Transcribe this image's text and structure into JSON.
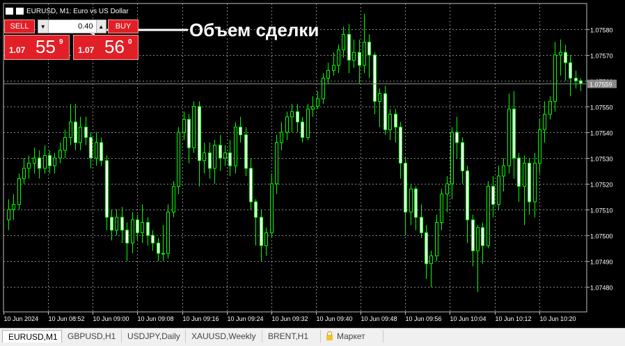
{
  "window": {
    "title": "EURUSD, M1:  Euro vs US Dollar"
  },
  "order_panel": {
    "sell_label": "SELL",
    "buy_label": "BUY",
    "volume": "0.40",
    "sell_price": {
      "prefix": "1.07",
      "big": "55",
      "sup": "9"
    },
    "buy_price": {
      "prefix": "1.07",
      "big": "56",
      "sup": "0"
    }
  },
  "annotation": {
    "text": "Объем сделки"
  },
  "tabs": [
    {
      "label": "EURUSD,M1",
      "active": true
    },
    {
      "label": "GBPUSD,H1",
      "active": false
    },
    {
      "label": "USDJPY,Daily",
      "active": false
    },
    {
      "label": "XAUUSD,Weekly",
      "active": false
    },
    {
      "label": "BRENT,H1",
      "active": false
    },
    {
      "label": "Маркет",
      "active": false,
      "icon": "lock-icon"
    }
  ],
  "colors": {
    "background": "#000000",
    "grid": "#c0c0c0",
    "bull": "#00ff00",
    "bear": "#ffffff",
    "button_red": "#e21f26"
  },
  "chart_data": {
    "type": "candlestick",
    "ylim": [
      1.0747,
      1.0759
    ],
    "y_ticks": [
      "1.07580",
      "1.07570",
      "1.07560",
      "1.07550",
      "1.07540",
      "1.07530",
      "1.07520",
      "1.07510",
      "1.07500",
      "1.07490",
      "1.07480"
    ],
    "x_labels": [
      "10 Jun 2024",
      "10 Jun 08:52",
      "10 Jun 09:00",
      "10 Jun 09:08",
      "10 Jun 09:16",
      "10 Jun 09:24",
      "10 Jun 09:32",
      "10 Jun 09:40",
      "10 Jun 09:48",
      "10 Jun 09:56",
      "10 Jun 10:04",
      "10 Jun 10:12",
      "10 Jun 10:20"
    ],
    "current_price": "1.07559",
    "grid": true,
    "candles": [
      [
        1.07506,
        1.0751,
        1.07514,
        1.07502
      ],
      [
        1.0751,
        1.07512,
        1.07516,
        1.07506
      ],
      [
        1.07512,
        1.07522,
        1.07524,
        1.0751
      ],
      [
        1.07522,
        1.07526,
        1.0753,
        1.0752
      ],
      [
        1.07526,
        1.07528,
        1.07531,
        1.07522
      ],
      [
        1.07528,
        1.0753,
        1.07534,
        1.07524
      ],
      [
        1.0753,
        1.07526,
        1.07533,
        1.07522
      ],
      [
        1.07526,
        1.07531,
        1.07535,
        1.07524
      ],
      [
        1.07531,
        1.07527,
        1.07533,
        1.07524
      ],
      [
        1.07527,
        1.0753,
        1.07532,
        1.07524
      ],
      [
        1.0753,
        1.07533,
        1.07536,
        1.07528
      ],
      [
        1.07533,
        1.07538,
        1.07541,
        1.0753
      ],
      [
        1.07538,
        1.07544,
        1.07551,
        1.07535
      ],
      [
        1.07544,
        1.07536,
        1.07551,
        1.07533
      ],
      [
        1.07536,
        1.07542,
        1.07546,
        1.07533
      ],
      [
        1.07542,
        1.07538,
        1.07546,
        1.07535
      ],
      [
        1.07538,
        1.0753,
        1.0754,
        1.07526
      ],
      [
        1.0753,
        1.07536,
        1.0754,
        1.07527
      ],
      [
        1.07536,
        1.07529,
        1.07538,
        1.07527
      ],
      [
        1.07529,
        1.07507,
        1.07531,
        1.07502
      ],
      [
        1.07507,
        1.07502,
        1.0751,
        1.07498
      ],
      [
        1.07502,
        1.07507,
        1.0751,
        1.075
      ],
      [
        1.07507,
        1.07502,
        1.07511,
        1.07497
      ],
      [
        1.07502,
        1.07497,
        1.07505,
        1.0749
      ],
      [
        1.07497,
        1.07506,
        1.07509,
        1.07493
      ],
      [
        1.07506,
        1.07501,
        1.07508,
        1.07498
      ],
      [
        1.07501,
        1.07505,
        1.07512,
        1.07497
      ],
      [
        1.07505,
        1.075,
        1.07507,
        1.07496
      ],
      [
        1.075,
        1.07497,
        1.07502,
        1.07494
      ],
      [
        1.07497,
        1.07493,
        1.07499,
        1.0749
      ],
      [
        1.07493,
        1.07493,
        1.07504,
        1.0749
      ],
      [
        1.07493,
        1.07509,
        1.07512,
        1.07491
      ],
      [
        1.07509,
        1.07519,
        1.07521,
        1.07507
      ],
      [
        1.07519,
        1.0754,
        1.07542,
        1.07516
      ],
      [
        1.0754,
        1.07545,
        1.07548,
        1.07537
      ],
      [
        1.07545,
        1.07534,
        1.07547,
        1.07528
      ],
      [
        1.07534,
        1.0755,
        1.07552,
        1.07532
      ],
      [
        1.0755,
        1.07529,
        1.07552,
        1.07519
      ],
      [
        1.07529,
        1.07532,
        1.07536,
        1.07524
      ],
      [
        1.07532,
        1.07526,
        1.07536,
        1.07522
      ],
      [
        1.07526,
        1.07535,
        1.07537,
        1.0752
      ],
      [
        1.07535,
        1.0753,
        1.07539,
        1.07525
      ],
      [
        1.0753,
        1.07532,
        1.07535,
        1.07527
      ],
      [
        1.07532,
        1.07527,
        1.07537,
        1.07523
      ],
      [
        1.07527,
        1.07542,
        1.07544,
        1.07524
      ],
      [
        1.07542,
        1.07539,
        1.07546,
        1.07536
      ],
      [
        1.07539,
        1.07526,
        1.07542,
        1.07523
      ],
      [
        1.07526,
        1.07513,
        1.0753,
        1.0751
      ],
      [
        1.07513,
        1.07507,
        1.07514,
        1.07496
      ],
      [
        1.07507,
        1.07496,
        1.0751,
        1.0749
      ],
      [
        1.07496,
        1.07501,
        1.07503,
        1.07492
      ],
      [
        1.07501,
        1.0752,
        1.07524,
        1.07499
      ],
      [
        1.0752,
        1.07536,
        1.07539,
        1.07516
      ],
      [
        1.07536,
        1.0754,
        1.07544,
        1.07533
      ],
      [
        1.0754,
        1.07546,
        1.07548,
        1.07537
      ],
      [
        1.07546,
        1.07548,
        1.07551,
        1.0754
      ],
      [
        1.07548,
        1.07544,
        1.07551,
        1.0754
      ],
      [
        1.07544,
        1.07538,
        1.07546,
        1.07536
      ],
      [
        1.07538,
        1.07549,
        1.07551,
        1.07537
      ],
      [
        1.07549,
        1.0755,
        1.07554,
        1.07546
      ],
      [
        1.0755,
        1.07553,
        1.07556,
        1.07549
      ],
      [
        1.07553,
        1.07561,
        1.07563,
        1.07551
      ],
      [
        1.07561,
        1.07564,
        1.07567,
        1.07559
      ],
      [
        1.07564,
        1.07566,
        1.07571,
        1.07562
      ],
      [
        1.07566,
        1.07572,
        1.07574,
        1.07563
      ],
      [
        1.07572,
        1.07578,
        1.07581,
        1.07569
      ],
      [
        1.07578,
        1.07568,
        1.07582,
        1.07563
      ],
      [
        1.07568,
        1.07571,
        1.07576,
        1.07565
      ],
      [
        1.07571,
        1.07566,
        1.07576,
        1.07559
      ],
      [
        1.07566,
        1.07575,
        1.07586,
        1.07563
      ],
      [
        1.07575,
        1.0757,
        1.07578,
        1.07561
      ],
      [
        1.0757,
        1.07552,
        1.07571,
        1.07547
      ],
      [
        1.07552,
        1.07555,
        1.07557,
        1.07542
      ],
      [
        1.07555,
        1.07541,
        1.07558,
        1.07539
      ],
      [
        1.07541,
        1.07547,
        1.07549,
        1.07537
      ],
      [
        1.07547,
        1.07542,
        1.07549,
        1.07536
      ],
      [
        1.07542,
        1.07528,
        1.07544,
        1.07522
      ],
      [
        1.07528,
        1.07509,
        1.0753,
        1.075
      ],
      [
        1.07509,
        1.07518,
        1.0752,
        1.07504
      ],
      [
        1.07518,
        1.07507,
        1.07519,
        1.07502
      ],
      [
        1.07507,
        1.07501,
        1.07512,
        1.07499
      ],
      [
        1.07501,
        1.07489,
        1.07504,
        1.07483
      ],
      [
        1.07489,
        1.07492,
        1.07494,
        1.0748
      ],
      [
        1.07492,
        1.07505,
        1.07508,
        1.0749
      ],
      [
        1.07505,
        1.07516,
        1.07518,
        1.07502
      ],
      [
        1.07516,
        1.0752,
        1.07523,
        1.07509
      ],
      [
        1.0752,
        1.0754,
        1.07542,
        1.07514
      ],
      [
        1.0754,
        1.07536,
        1.07546,
        1.0753
      ],
      [
        1.07536,
        1.07525,
        1.07538,
        1.0752
      ],
      [
        1.07525,
        1.07506,
        1.07527,
        1.07497
      ],
      [
        1.07506,
        1.07494,
        1.07508,
        1.07488
      ],
      [
        1.07494,
        1.07503,
        1.07504,
        1.07478
      ],
      [
        1.07503,
        1.07496,
        1.07505,
        1.07489
      ],
      [
        1.07496,
        1.07519,
        1.07521,
        1.07495
      ],
      [
        1.07519,
        1.07512,
        1.07523,
        1.07507
      ],
      [
        1.07512,
        1.07523,
        1.07527,
        1.0751
      ],
      [
        1.07523,
        1.07527,
        1.0753,
        1.07517
      ],
      [
        1.07527,
        1.07549,
        1.07555,
        1.07524
      ],
      [
        1.07549,
        1.0753,
        1.07556,
        1.07522
      ],
      [
        1.0753,
        1.07519,
        1.07532,
        1.07513
      ],
      [
        1.07519,
        1.07528,
        1.07531,
        1.07504
      ],
      [
        1.07528,
        1.07513,
        1.0753,
        1.07508
      ],
      [
        1.07513,
        1.07528,
        1.07532,
        1.07507
      ],
      [
        1.07528,
        1.07541,
        1.07545,
        1.07524
      ],
      [
        1.07541,
        1.07547,
        1.07552,
        1.07536
      ],
      [
        1.07547,
        1.07552,
        1.07554,
        1.07545
      ],
      [
        1.07552,
        1.0757,
        1.07575,
        1.07548
      ],
      [
        1.0757,
        1.07571,
        1.07576,
        1.07562
      ],
      [
        1.07571,
        1.07567,
        1.07574,
        1.0756
      ],
      [
        1.07567,
        1.07561,
        1.0757,
        1.07554
      ],
      [
        1.07561,
        1.0756,
        1.07564,
        1.07557
      ],
      [
        1.0756,
        1.07559,
        1.07561,
        1.07556
      ]
    ]
  }
}
